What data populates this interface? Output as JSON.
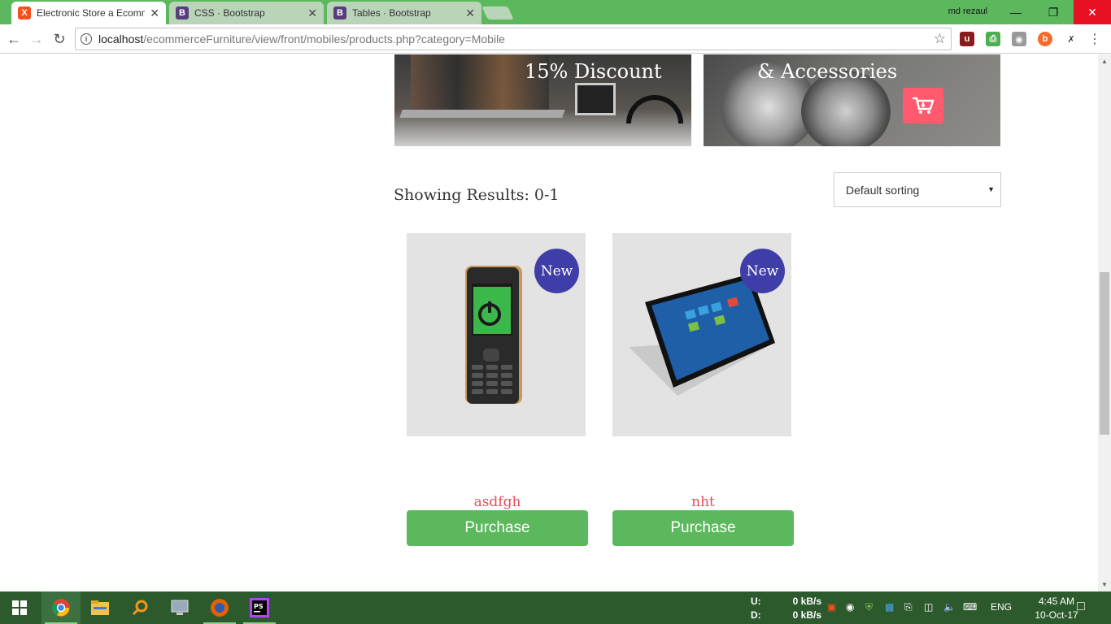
{
  "browser": {
    "tabs": [
      {
        "label": "Electronic Store a Ecomm",
        "favicon": "X",
        "close": "✕"
      },
      {
        "label": "CSS · Bootstrap",
        "favicon": "B",
        "close": "✕"
      },
      {
        "label": "Tables · Bootstrap",
        "favicon": "B",
        "close": "✕"
      }
    ],
    "user": "md rezaul",
    "url_host": "localhost",
    "url_path": "/ecommerceFurniture/view/front/mobiles/products.php?category=Mobile"
  },
  "banners": [
    {
      "title": "15% Discount"
    },
    {
      "title": "& Accessories"
    }
  ],
  "results_text": "Showing Results: 0-1",
  "sort": {
    "selected": "Default sorting"
  },
  "products": [
    {
      "name": "asdfgh",
      "badge": "New",
      "button": "Purchase"
    },
    {
      "name": "nht",
      "badge": "New",
      "button": "Purchase"
    }
  ],
  "taskbar": {
    "upload_label": "U:",
    "download_label": "D:",
    "upload_speed": "0 kB/s",
    "download_speed": "0 kB/s",
    "language": "ENG",
    "time": "4:45 AM",
    "date": "10-Oct-17"
  },
  "colors": {
    "accent_green": "#5cb85c",
    "badge_blue": "#3f3ea8",
    "product_name_red": "#e74c5c",
    "cart_pink": "#ff5a6e"
  }
}
